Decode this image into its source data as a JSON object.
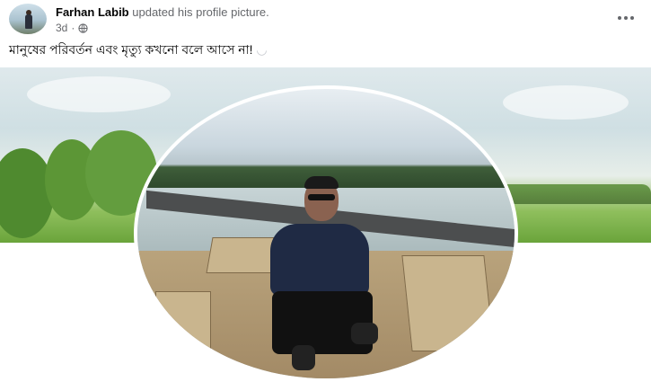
{
  "post": {
    "author": "Farhan Labib",
    "action": "updated his profile picture.",
    "time": "3d",
    "dot": "·",
    "caption": "মানুষের পরিবর্তন এবং মৃত্যু কখনো বলে আসে না!",
    "caption_emoji": "◡",
    "audience_icon": "globe-icon",
    "menu_icon": "more-options-icon"
  },
  "colors": {
    "name_text": "#050505",
    "secondary_text": "#65676b",
    "background": "#ffffff"
  }
}
